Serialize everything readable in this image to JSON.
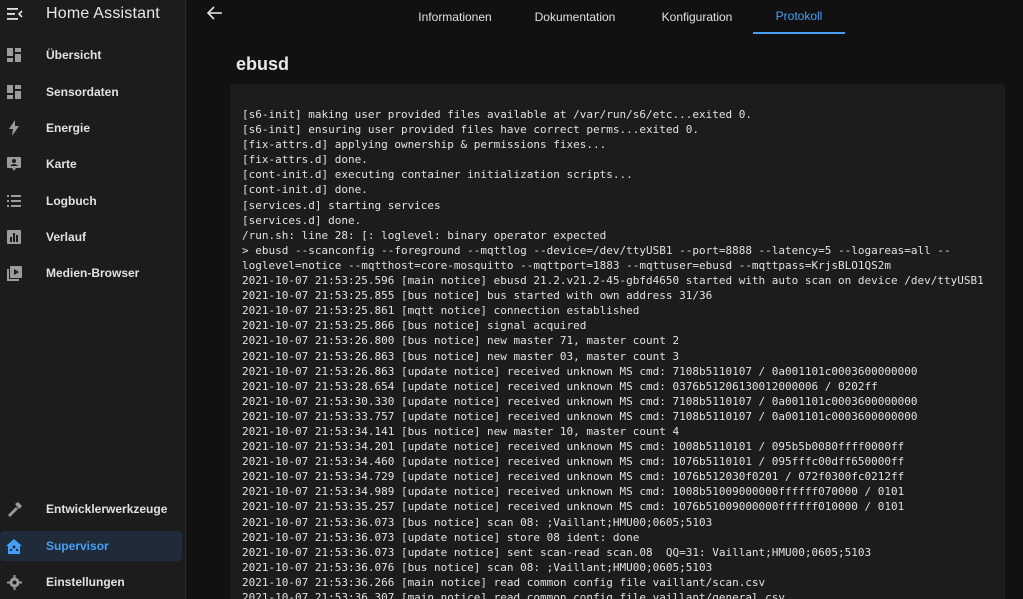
{
  "app": {
    "title": "Home Assistant"
  },
  "sidebar": {
    "items": [
      {
        "label": "Übersicht",
        "icon": "dashboard-icon"
      },
      {
        "label": "Sensordaten",
        "icon": "dashboard-icon"
      },
      {
        "label": "Energie",
        "icon": "lightning-icon"
      },
      {
        "label": "Karte",
        "icon": "map-marker-icon"
      },
      {
        "label": "Logbuch",
        "icon": "list-icon"
      },
      {
        "label": "Verlauf",
        "icon": "chart-icon"
      },
      {
        "label": "Medien-Browser",
        "icon": "play-box-icon"
      }
    ],
    "bottom_items": [
      {
        "label": "Entwicklerwerkzeuge",
        "icon": "hammer-icon"
      },
      {
        "label": "Supervisor",
        "icon": "home-assistant-icon",
        "active": true
      },
      {
        "label": "Einstellungen",
        "icon": "gear-icon"
      }
    ]
  },
  "tabs": [
    {
      "label": "Informationen"
    },
    {
      "label": "Dokumentation"
    },
    {
      "label": "Konfiguration"
    },
    {
      "label": "Protokoll",
      "active": true
    }
  ],
  "main": {
    "title": "ebusd",
    "log": [
      "[s6-init] making user provided files available at /var/run/s6/etc...exited 0.",
      "[s6-init] ensuring user provided files have correct perms...exited 0.",
      "[fix-attrs.d] applying ownership & permissions fixes...",
      "[fix-attrs.d] done.",
      "[cont-init.d] executing container initialization scripts...",
      "[cont-init.d] done.",
      "[services.d] starting services",
      "[services.d] done.",
      "/run.sh: line 28: [: loglevel: binary operator expected",
      "> ebusd --scanconfig --foreground --mqttlog --device=/dev/ttyUSB1 --port=8888 --latency=5 --logareas=all --",
      "loglevel=notice --mqtthost=core-mosquitto --mqttport=1883 --mqttuser=ebusd --mqttpass=KrjsBLO1QS2m",
      "2021-10-07 21:53:25.596 [main notice] ebusd 21.2.v21.2-45-gbfd4650 started with auto scan on device /dev/ttyUSB1",
      "2021-10-07 21:53:25.855 [bus notice] bus started with own address 31/36",
      "2021-10-07 21:53:25.861 [mqtt notice] connection established",
      "2021-10-07 21:53:25.866 [bus notice] signal acquired",
      "2021-10-07 21:53:26.800 [bus notice] new master 71, master count 2",
      "2021-10-07 21:53:26.863 [bus notice] new master 03, master count 3",
      "2021-10-07 21:53:26.863 [update notice] received unknown MS cmd: 7108b5110107 / 0a001101c0003600000000",
      "2021-10-07 21:53:28.654 [update notice] received unknown MS cmd: 0376b51206130012000006 / 0202ff",
      "2021-10-07 21:53:30.330 [update notice] received unknown MS cmd: 7108b5110107 / 0a001101c0003600000000",
      "2021-10-07 21:53:33.757 [update notice] received unknown MS cmd: 7108b5110107 / 0a001101c0003600000000",
      "2021-10-07 21:53:34.141 [bus notice] new master 10, master count 4",
      "2021-10-07 21:53:34.201 [update notice] received unknown MS cmd: 1008b5110101 / 095b5b0080ffff0000ff",
      "2021-10-07 21:53:34.460 [update notice] received unknown MS cmd: 1076b5110101 / 095fffc00dff650000ff",
      "2021-10-07 21:53:34.729 [update notice] received unknown MS cmd: 1076b512030f0201 / 072f0300fc0212ff",
      "2021-10-07 21:53:34.989 [update notice] received unknown MS cmd: 1008b51009000000ffffff070000 / 0101",
      "2021-10-07 21:53:35.257 [update notice] received unknown MS cmd: 1076b51009000000ffffff010000 / 0101",
      "2021-10-07 21:53:36.073 [bus notice] scan 08: ;Vaillant;HMU00;0605;5103",
      "2021-10-07 21:53:36.073 [update notice] store 08 ident: done",
      "2021-10-07 21:53:36.073 [update notice] sent scan-read scan.08  QQ=31: Vaillant;HMU00;0605;5103",
      "2021-10-07 21:53:36.076 [bus notice] scan 08: ;Vaillant;HMU00;0605;5103",
      "2021-10-07 21:53:36.266 [main notice] read common config file vaillant/scan.csv",
      "2021-10-07 21:53:36.307 [main notice] read common config file vaillant/general.csv"
    ]
  },
  "colors": {
    "accent": "#45a0f5",
    "background": "#111111",
    "card": "#1c1c1c",
    "sidebar": "#1c1c1c"
  }
}
